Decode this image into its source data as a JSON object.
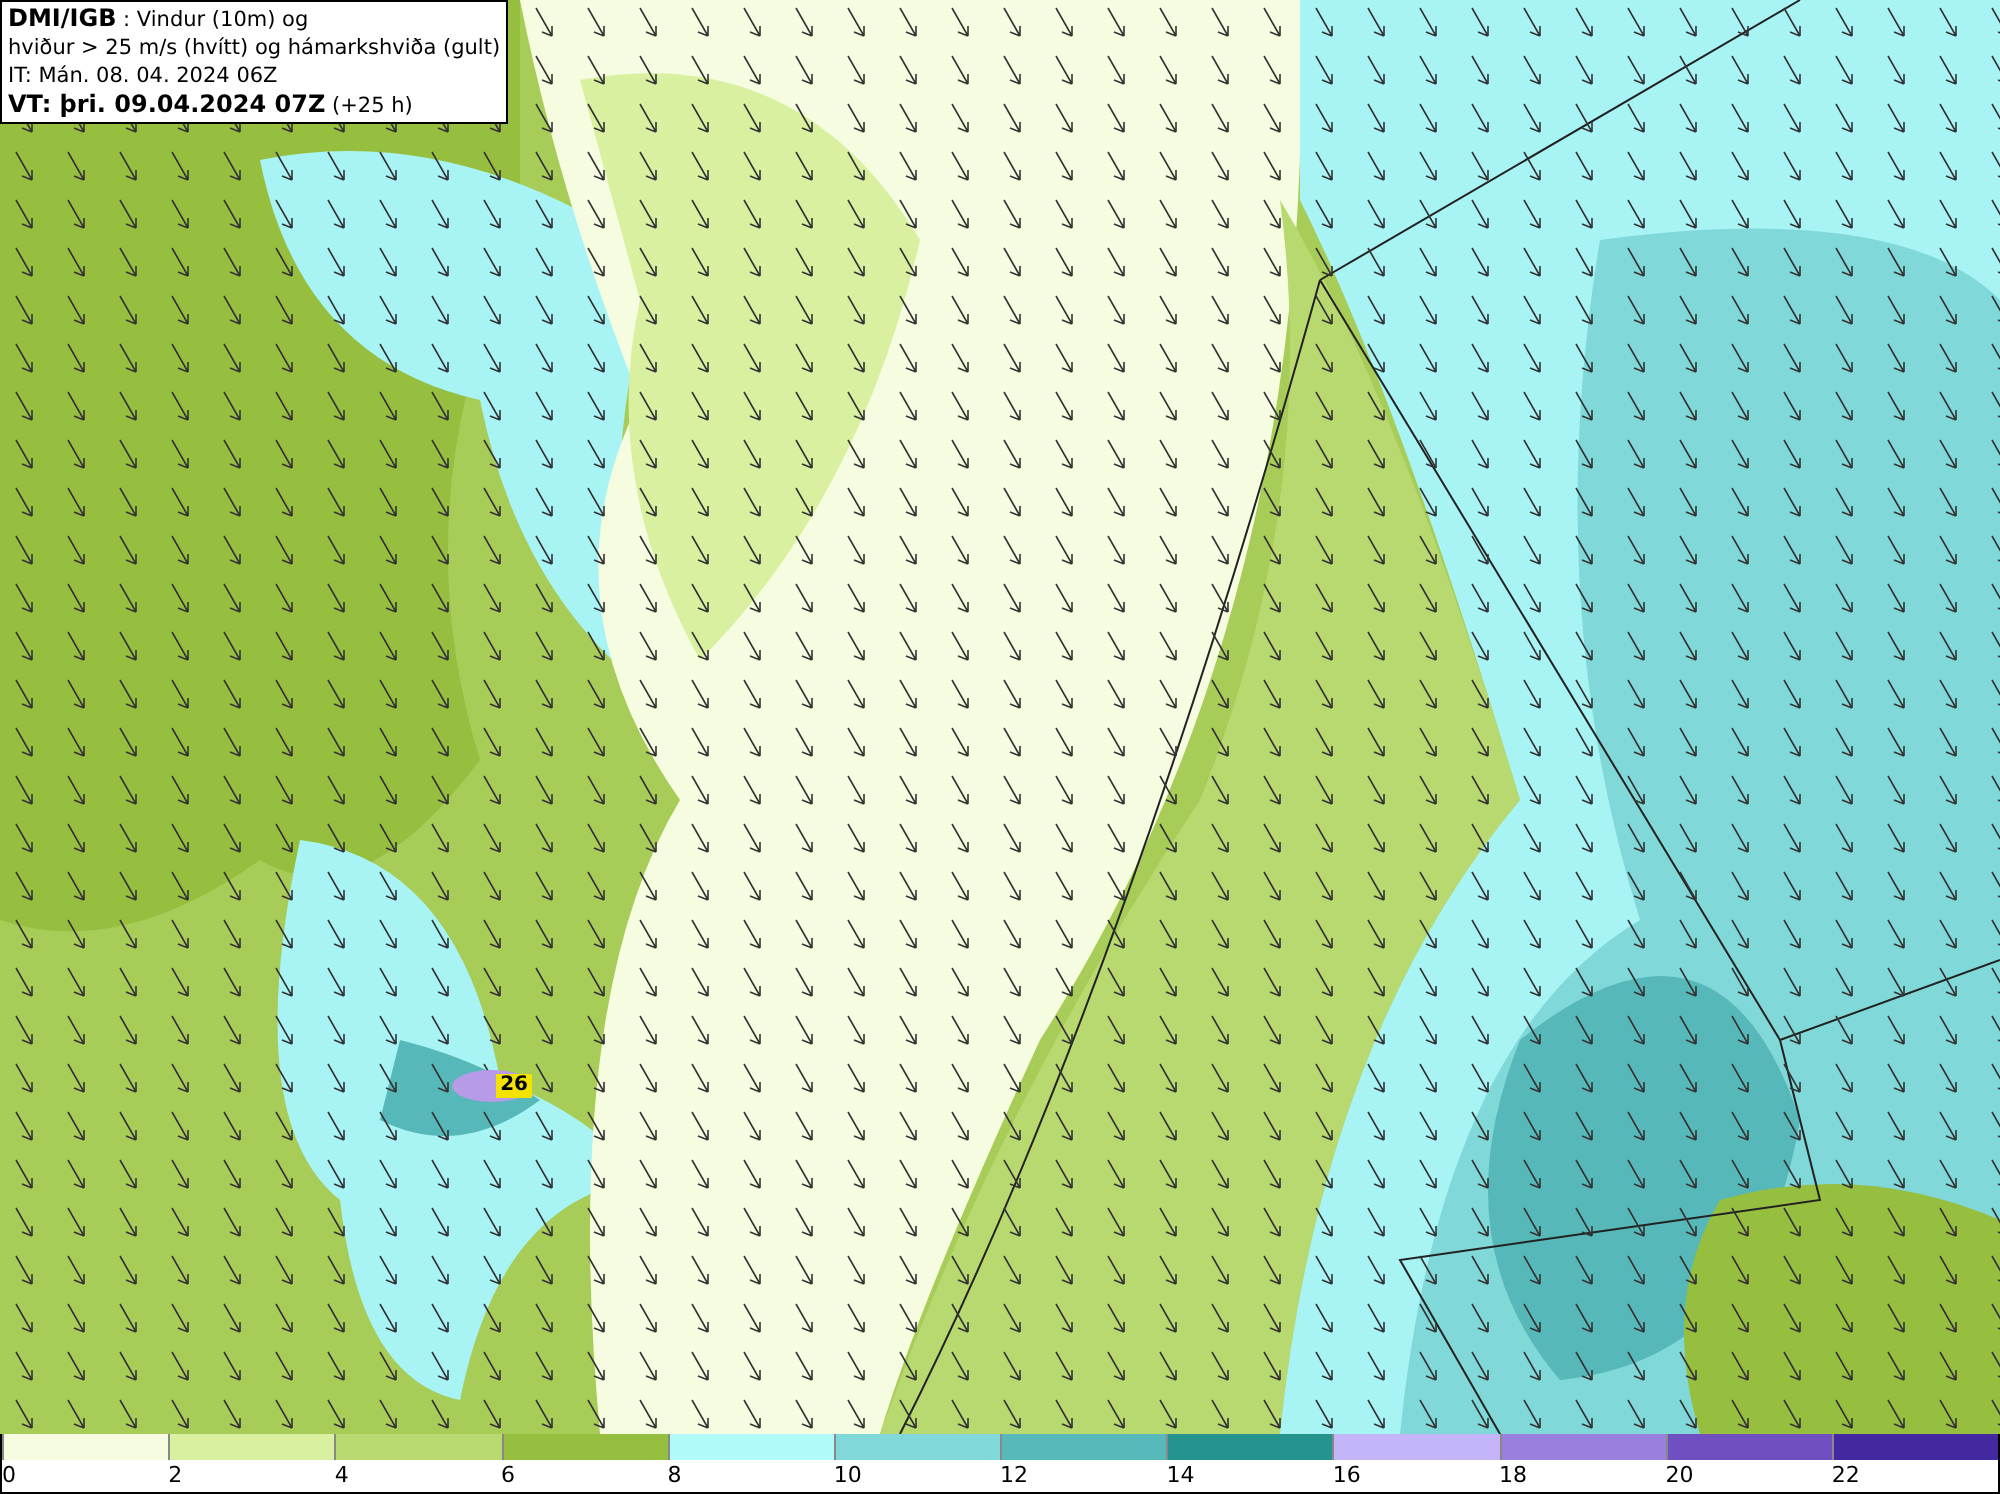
{
  "header": {
    "line1": "**DMI/IGB** : Vindur (10m) og",
    "line2": "hviður > 25 m/s (hvítt) og hámarkshviða (gult)",
    "line3": "IT: Mán. 08. 04. 2024 06Z",
    "line4": "**VT: þri. 09.04.2024 07Z** (+25 h)"
  },
  "gust_marker": {
    "value": "26"
  },
  "legend": {
    "bins": [
      {
        "color": "#f5fce0"
      },
      {
        "color": "#d9f0a0"
      },
      {
        "color": "#b8d870"
      },
      {
        "color": "#96bf40"
      },
      {
        "color": "#b0fafa"
      },
      {
        "color": "#80d8d8"
      },
      {
        "color": "#56b8b8"
      },
      {
        "color": "#26948e"
      },
      {
        "color": "#c4b4f8"
      },
      {
        "color": "#9880dc"
      },
      {
        "color": "#7050c0"
      },
      {
        "color": "#4428a0"
      }
    ],
    "ticks": [
      "0",
      "2",
      "4",
      "6",
      "8",
      "10",
      "12",
      "14",
      "16",
      "18",
      "20",
      "22"
    ]
  }
}
